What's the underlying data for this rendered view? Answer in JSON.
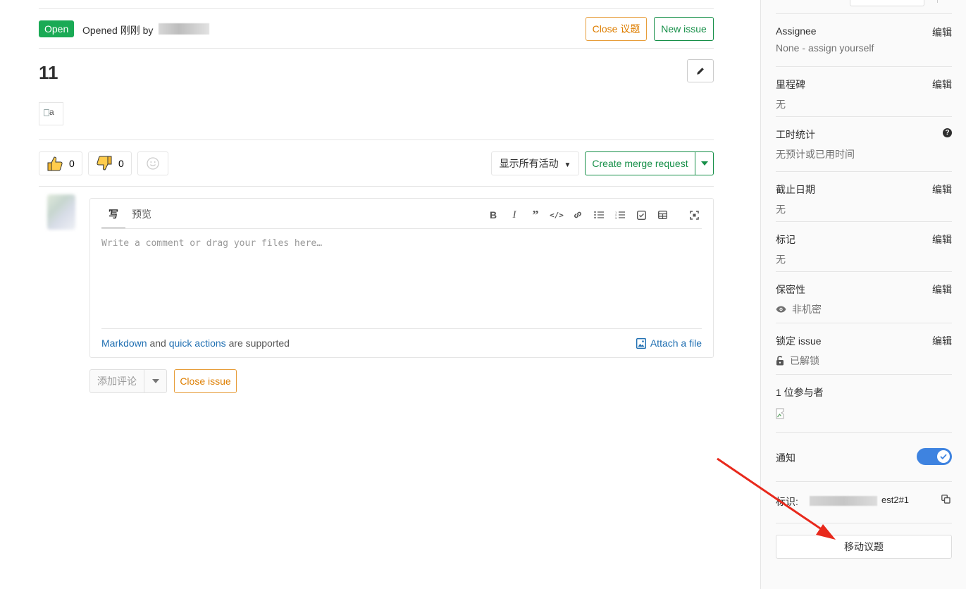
{
  "header": {
    "status": "Open",
    "opened_text": "Opened 刚刚 by",
    "close_issue_label": "Close 议题",
    "new_issue_label": "New issue"
  },
  "issue": {
    "title": "11",
    "broken_image_alt": "a"
  },
  "awards": {
    "thumbs_up_count": "0",
    "thumbs_down_count": "0"
  },
  "toolbar": {
    "activity_filter_label": "显示所有活动",
    "create_merge_request_label": "Create merge request"
  },
  "editor": {
    "tab_write": "写",
    "tab_preview": "预览",
    "placeholder": "Write a comment or drag your files here…",
    "footer_link_markdown": "Markdown",
    "footer_and": "and",
    "footer_link_quick_actions": "quick actions",
    "footer_supported": "are supported",
    "attach_label": "Attach a file"
  },
  "comment_actions": {
    "add_comment_label": "添加评论",
    "close_issue_label": "Close issue"
  },
  "sidebar": {
    "assignee": {
      "label": "Assignee",
      "edit": "编辑",
      "value_none": "None -",
      "value_link": "assign yourself"
    },
    "milestone": {
      "label": "里程碑",
      "edit": "编辑",
      "value": "无"
    },
    "time_tracking": {
      "label": "工时统计",
      "value": "无预计或已用时间"
    },
    "due_date": {
      "label": "截止日期",
      "edit": "编辑",
      "value": "无"
    },
    "labels": {
      "label": "标记",
      "edit": "编辑",
      "value": "无"
    },
    "confidentiality": {
      "label": "保密性",
      "edit": "编辑",
      "value": "非机密"
    },
    "lock": {
      "label": "锁定 issue",
      "edit": "编辑",
      "value": "已解锁"
    },
    "participants": {
      "label": "1 位参与者"
    },
    "notifications": {
      "label": "通知",
      "enabled": true
    },
    "reference": {
      "label": "标识:",
      "value_visible": "est2#1"
    },
    "move_issue_label": "移动议题"
  },
  "colors": {
    "open_badge": "#1aaa55",
    "green_button": "#168f48",
    "orange_button": "#de7e00",
    "link": "#1f6fb2",
    "toggle": "#3e83e0",
    "annotation_arrow": "#e8291c"
  }
}
